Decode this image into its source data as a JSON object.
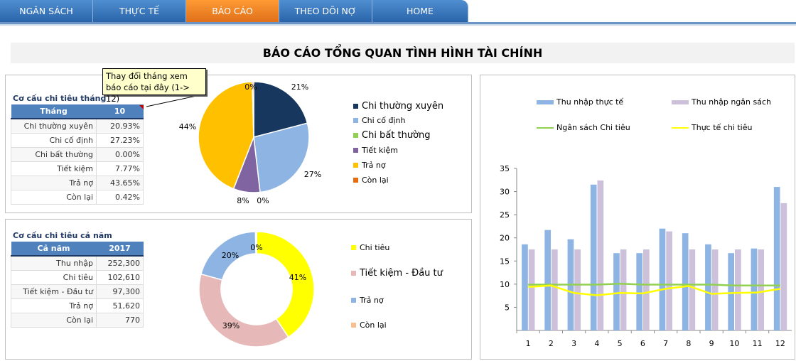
{
  "nav": {
    "tabs": [
      "NGÂN SÁCH",
      "THỰC TẾ",
      "BÁO CÁO",
      "THEO DÕI NỢ",
      "HOME"
    ],
    "active": "BÁO CÁO"
  },
  "title": "BÁO CÁO TỔNG QUAN TÌNH HÌNH TÀI CHÍNH",
  "tooltip": "Thay đổi tháng xem báo cáo tại đây (1-> 12)",
  "monthly": {
    "heading": "Cơ cấu chi tiêu tháng",
    "header": [
      "Tháng",
      "10"
    ],
    "rows": [
      [
        "Chi thường xuyên",
        "20.93%"
      ],
      [
        "Chi cố định",
        "27.23%"
      ],
      [
        "Chi bất thường",
        "0.00%"
      ],
      [
        "Tiết kiệm",
        "7.77%"
      ],
      [
        "Trả nợ",
        "43.65%"
      ],
      [
        "Còn lại",
        "0.42%"
      ]
    ]
  },
  "yearly": {
    "heading": "Cơ cấu chi tiêu cả năm",
    "header": [
      "Cả năm",
      "2017"
    ],
    "rows": [
      [
        "Thu nhập",
        "252,300"
      ],
      [
        "Chi tiêu",
        "102,610"
      ],
      [
        "Tiết kiệm - Đầu tư",
        "97,300"
      ],
      [
        "Trả nợ",
        "51,620"
      ],
      [
        "Còn lại",
        "770"
      ]
    ]
  },
  "chart_data": [
    {
      "type": "pie",
      "categories": [
        "Chi thường xuyên",
        "Chi cố định",
        "Chi bất thường",
        "Tiết kiệm",
        "Trả nợ",
        "Còn lại"
      ],
      "values": [
        20.93,
        27.23,
        0,
        7.77,
        43.65,
        0.42
      ],
      "data_labels": [
        "21%",
        "27%",
        "0%",
        "8%",
        "44%",
        "0%"
      ],
      "colors": [
        "#17375e",
        "#8db4e2",
        "#92d050",
        "#8064a2",
        "#ffc000",
        "#e46c0a"
      ],
      "legend": "right"
    },
    {
      "type": "pie",
      "donut": true,
      "categories": [
        "Chi tiêu",
        "Tiết kiệm - Đầu tư",
        "Trả nợ",
        "Còn lại"
      ],
      "values": [
        102610,
        97300,
        51620,
        770
      ],
      "data_labels": [
        "41%",
        "39%",
        "20%",
        "0%"
      ],
      "colors": [
        "#ffff00",
        "#e6b9b8",
        "#8db4e2",
        "#fabf8f"
      ],
      "legend": "right"
    },
    {
      "type": "bar",
      "categories": [
        "1",
        "2",
        "3",
        "4",
        "5",
        "6",
        "7",
        "8",
        "9",
        "10",
        "11",
        "12"
      ],
      "ylim": [
        0,
        35
      ],
      "yticks": [
        "5",
        "10",
        "15",
        "20",
        "25",
        "30",
        "35"
      ],
      "legend": "top",
      "grid": false,
      "series": [
        {
          "name": "Thu nhập thực tế",
          "kind": "bar",
          "color": "#8db4e2",
          "values": [
            18.6,
            21.7,
            19.7,
            31.5,
            16.7,
            16.7,
            22,
            21,
            18.6,
            16.7,
            17.7,
            31
          ]
        },
        {
          "name": "Thu nhập ngân sách",
          "kind": "bar",
          "color": "#ccc0da",
          "values": [
            17.5,
            17.5,
            17.5,
            32.4,
            17.5,
            17.5,
            21.4,
            17.5,
            17.5,
            17.5,
            17.5,
            27.5
          ]
        },
        {
          "name": "Ngân sách Chi tiêu",
          "kind": "line",
          "color": "#92d050",
          "values": [
            9.9,
            9.9,
            9.9,
            9.9,
            10.1,
            9.9,
            9.9,
            9.9,
            9.9,
            9.7,
            9.7,
            9.7
          ]
        },
        {
          "name": "Thực tế chi tiêu",
          "kind": "line",
          "color": "#ffff00",
          "values": [
            9.4,
            9.7,
            8.1,
            7.6,
            8.1,
            8.0,
            9.0,
            9.6,
            7.9,
            8.1,
            8.2,
            9.0
          ]
        }
      ]
    }
  ]
}
